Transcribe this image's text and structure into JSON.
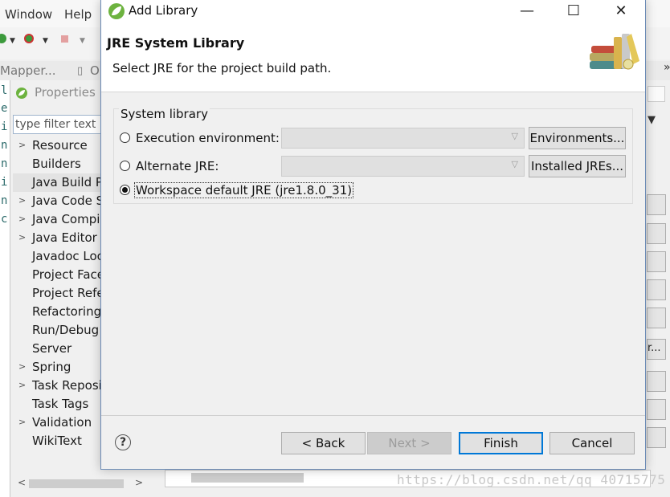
{
  "background": {
    "menu": [
      "Window",
      "Help"
    ],
    "tabs": [
      "Mapper...",
      "O"
    ],
    "editor_chars": [
      "l",
      "e",
      "i",
      "n",
      "n",
      "i",
      "n",
      "c"
    ],
    "properties": {
      "title": "Properties",
      "filter_placeholder": "type filter text",
      "tree": [
        {
          "label": "Resource",
          "expandable": true
        },
        {
          "label": "Builders",
          "expandable": false
        },
        {
          "label": "Java Build Path",
          "expandable": false,
          "selected": true
        },
        {
          "label": "Java Code Style",
          "expandable": true
        },
        {
          "label": "Java Compiler",
          "expandable": true
        },
        {
          "label": "Java Editor",
          "expandable": true
        },
        {
          "label": "Javadoc Location",
          "expandable": false
        },
        {
          "label": "Project Facets",
          "expandable": false
        },
        {
          "label": "Project References",
          "expandable": false
        },
        {
          "label": "Refactoring History",
          "expandable": false
        },
        {
          "label": "Run/Debug Settings",
          "expandable": false
        },
        {
          "label": "Server",
          "expandable": false
        },
        {
          "label": "Spring",
          "expandable": true
        },
        {
          "label": "Task Repository",
          "expandable": true
        },
        {
          "label": "Task Tags",
          "expandable": false
        },
        {
          "label": "Validation",
          "expandable": true
        },
        {
          "label": "WikiText",
          "expandable": false
        }
      ]
    },
    "watermark": "https://blog.csdn.net/qq_40715775",
    "right_overflow": "»",
    "right_btn_text": "r..."
  },
  "dialog": {
    "title": "Add Library",
    "banner_title": "JRE System Library",
    "banner_subtitle": "Select JRE for the project build path.",
    "group_label": "System library",
    "options": {
      "execution_env": {
        "label": "Execution environment:",
        "selected": false,
        "button": "Environments..."
      },
      "alternate_jre": {
        "label": "Alternate JRE:",
        "selected": false,
        "button": "Installed JREs..."
      },
      "workspace_default": {
        "label": "Workspace default JRE (jre1.8.0_31)",
        "selected": true
      }
    },
    "buttons": {
      "back": "< Back",
      "next": "Next >",
      "finish": "Finish",
      "cancel": "Cancel"
    },
    "window_controls": {
      "minimize": "—",
      "maximize": "☐",
      "close": "✕"
    },
    "help": "?"
  },
  "colors": {
    "accent": "#0078d7",
    "spring_green": "#6db33f"
  }
}
